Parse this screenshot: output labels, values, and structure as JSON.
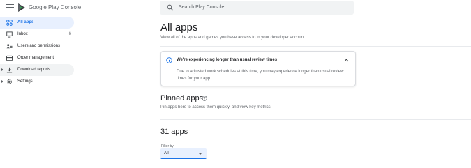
{
  "app": {
    "brand": "Google Play Console",
    "menu_icon": "hamburger-menu-icon",
    "logo_icon": "play-console-logo-icon"
  },
  "sidebar": {
    "items": [
      {
        "label": "All apps",
        "icon": "grid-icon",
        "active": true
      },
      {
        "label": "Inbox",
        "icon": "inbox-icon",
        "count": "6"
      },
      {
        "label": "Users and permissions",
        "icon": "people-icon"
      },
      {
        "label": "Order management",
        "icon": "credit-card-icon"
      },
      {
        "label": "Download reports",
        "icon": "download-icon",
        "expandable": true
      },
      {
        "label": "Settings",
        "icon": "gear-icon",
        "expandable": true
      }
    ]
  },
  "search": {
    "placeholder": "Search Play Console",
    "icon": "search-icon"
  },
  "main": {
    "title": "All apps",
    "description": "View all of the apps and games you have access to in your developer account",
    "notice": {
      "title": "We're experiencing longer than usual review times",
      "body": "Due to adjusted work schedules at this time, you may experience longer than usual review times for your app."
    },
    "pinned": {
      "title": "Pinned apps",
      "description": "Pin apps here to access them quickly, and view key metrics"
    },
    "apps": {
      "count_title": "31 apps",
      "filter_label": "Filter by",
      "filter_value": "All"
    }
  },
  "colors": {
    "accent": "#1a73e8",
    "active_bg": "#e8f0fe",
    "text_secondary": "#5f6368"
  }
}
